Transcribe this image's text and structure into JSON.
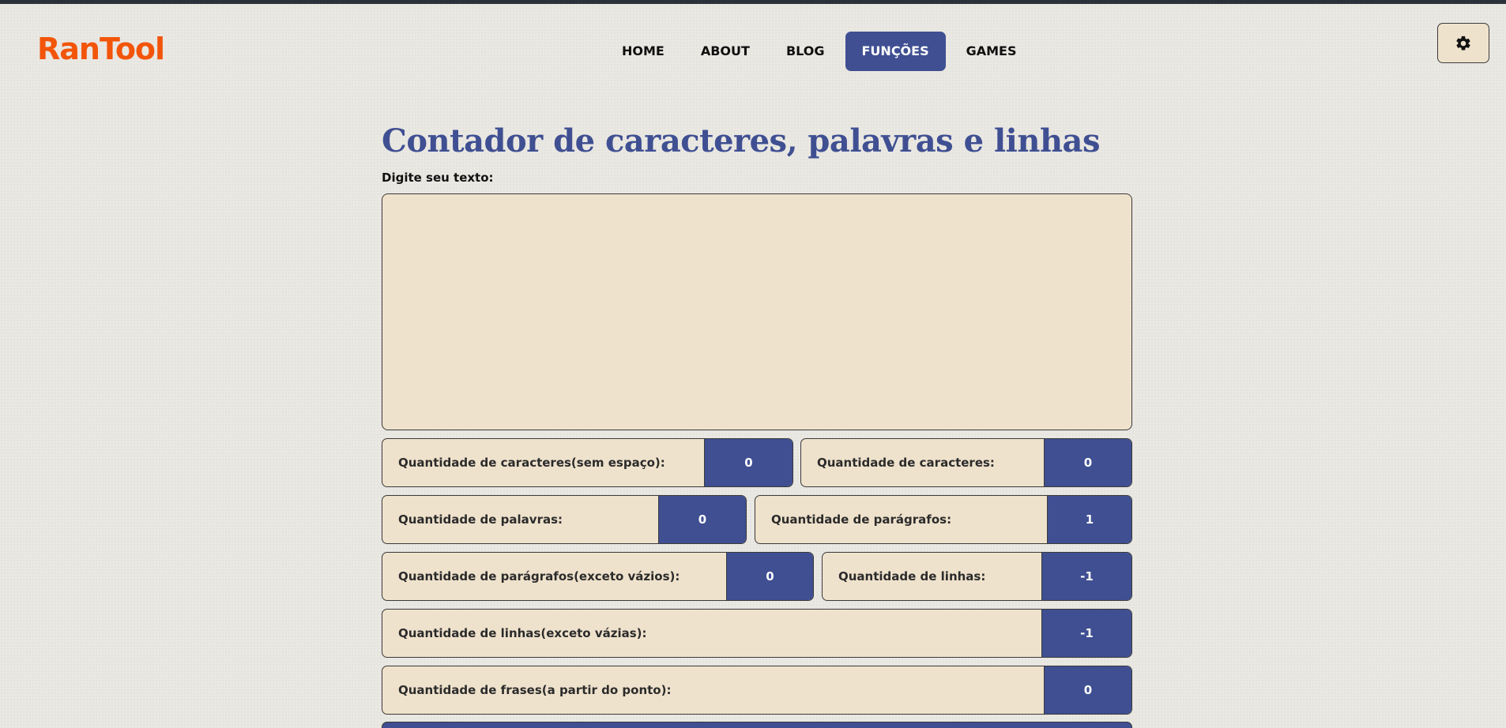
{
  "header": {
    "logo": "RanTool",
    "nav": [
      {
        "label": "HOME",
        "active": false
      },
      {
        "label": "ABOUT",
        "active": false
      },
      {
        "label": "BLOG",
        "active": false
      },
      {
        "label": "FUNÇÕES",
        "active": true
      },
      {
        "label": "GAMES",
        "active": false
      }
    ],
    "settings_icon": "gear-icon"
  },
  "main": {
    "title": "Contador de caracteres, palavras e linhas",
    "input_label": "Digite seu texto:",
    "textarea_value": "",
    "stats": [
      {
        "label": "Quantidade de caracteres(sem espaço):",
        "value": "0"
      },
      {
        "label": "Quantidade de caracteres:",
        "value": "0"
      },
      {
        "label": "Quantidade de palavras:",
        "value": "0"
      },
      {
        "label": "Quantidade de parágrafos:",
        "value": "1"
      },
      {
        "label": "Quantidade de parágrafos(exceto vázios):",
        "value": "0"
      },
      {
        "label": "Quantidade de linhas:",
        "value": "-1"
      },
      {
        "label": "Quantidade de linhas(exceto vázias):",
        "value": "-1"
      },
      {
        "label": "Quantidade de frases(a partir do ponto):",
        "value": "0"
      }
    ]
  },
  "colors": {
    "accent": "#3f4f92",
    "logo": "#f2550a",
    "panel": "#efe2cc",
    "background": "#eae8e3"
  }
}
